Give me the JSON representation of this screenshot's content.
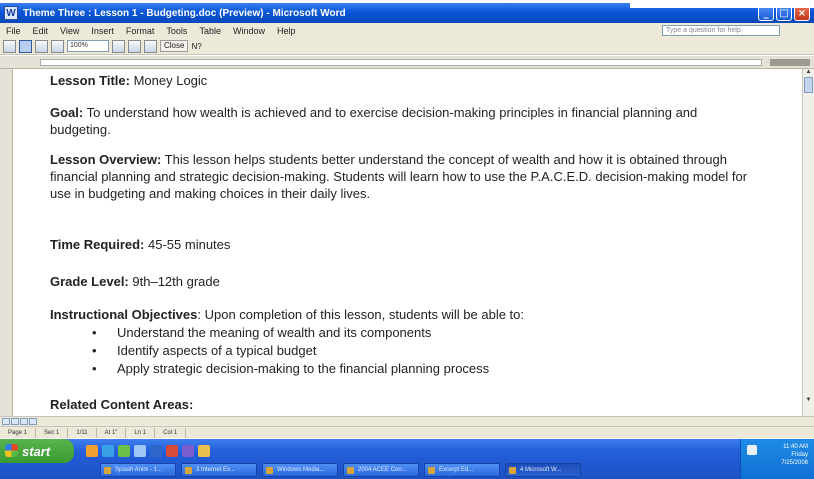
{
  "window": {
    "title": "Theme Three : Lesson 1 - Budgeting.doc (Preview) - Microsoft Word"
  },
  "menu": [
    "File",
    "Edit",
    "View",
    "Insert",
    "Format",
    "Tools",
    "Table",
    "Window",
    "Help"
  ],
  "help_box": {
    "placeholder": "Type a question for help"
  },
  "toolbar": {
    "zoom": "100%",
    "close_label": "Close",
    "help_label": "N?"
  },
  "document": {
    "lesson_title": {
      "label": "Lesson Title:",
      "value": "Money Logic"
    },
    "goal": {
      "label": "Goal:",
      "value": "To understand how wealth is achieved and to exercise decision-making principles in financial planning and budgeting."
    },
    "overview": {
      "label": "Lesson Overview:",
      "value": "This lesson helps students better understand the concept of wealth and how it is obtained through financial planning and strategic decision-making.  Students will learn how to use the P.A.C.E.D. decision-making model for use in budgeting and making choices in their daily lives."
    },
    "time_required": {
      "label": "Time Required:",
      "value": "45-55 minutes"
    },
    "grade_level": {
      "label": "Grade Level:",
      "value": "9th–12th grade"
    },
    "objectives": {
      "label": "Instructional Objectives",
      "value": ":  Upon completion of this lesson, students will be able to:",
      "items": [
        "Understand the meaning of wealth and its components",
        "Identify aspects of a typical budget",
        "Apply strategic decision-making to the financial planning process"
      ],
      "bullet": "•"
    },
    "related": {
      "label": "Related Content Areas:"
    }
  },
  "status": {
    "page": "Page 1",
    "sec": "Sec 1",
    "position": "1/11",
    "at": "At 1\"",
    "ln": "Ln 1",
    "col": "Col 1"
  },
  "taskbar": {
    "start_label": "start",
    "tasks": [
      "Splash Anim - 1...",
      "3 Internet Ex...",
      "Windows Media...",
      "2004 ACEE Con...",
      "Excerpt Ed...",
      "4 Microsoft W..."
    ],
    "clock": [
      "11:40 AM",
      "Friday",
      "7/25/2008"
    ]
  },
  "colors": {
    "titlebar": "#0a56d8",
    "taskbar": "#245edb",
    "start_button": "#3a9a32",
    "menubar": "#ece9d8"
  }
}
